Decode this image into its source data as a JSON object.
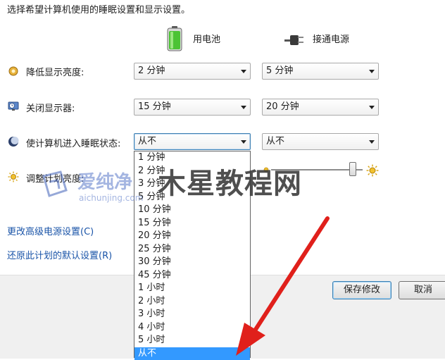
{
  "heading": "选择希望计算机使用的睡眠设置和显示设置。",
  "columns": {
    "battery": {
      "label": "用电池",
      "icon": "battery-icon"
    },
    "plugged": {
      "label": "接通电源",
      "icon": "power-plug-icon"
    }
  },
  "rows": [
    {
      "label": "降低显示亮度:",
      "icon": "dim-display-icon",
      "battery": "2 分钟",
      "plugged": "5 分钟"
    },
    {
      "label": "关闭显示器:",
      "icon": "monitor-clock-icon",
      "battery": "15 分钟",
      "plugged": "20 分钟"
    },
    {
      "label": "使计算机进入睡眠状态:",
      "icon": "moon-icon",
      "battery": "从不",
      "plugged": "从不"
    },
    {
      "label": "调整计划亮度:",
      "icon": "sun-icon"
    }
  ],
  "dropdown": {
    "options": [
      "1 分钟",
      "2 分钟",
      "3 分钟",
      "5 分钟",
      "10 分钟",
      "15 分钟",
      "20 分钟",
      "25 分钟",
      "30 分钟",
      "45 分钟",
      "1 小时",
      "2 小时",
      "3 小时",
      "4 小时",
      "5 小时",
      "从不"
    ],
    "selected_index": 15
  },
  "brightness": {
    "level": 0.9
  },
  "links": {
    "advanced": "更改高级电源设置(C)",
    "restore": "还原此计划的默认设置(R)"
  },
  "buttons": {
    "save": "保存修改",
    "cancel": "取消"
  },
  "watermark": {
    "site_cn": "爱纯净",
    "site_url": "aichunjing.com",
    "overlay": "木星教程网"
  },
  "colors": {
    "selection": "#3399ff",
    "link": "#1a54a8",
    "arrow": "#e0201b"
  }
}
